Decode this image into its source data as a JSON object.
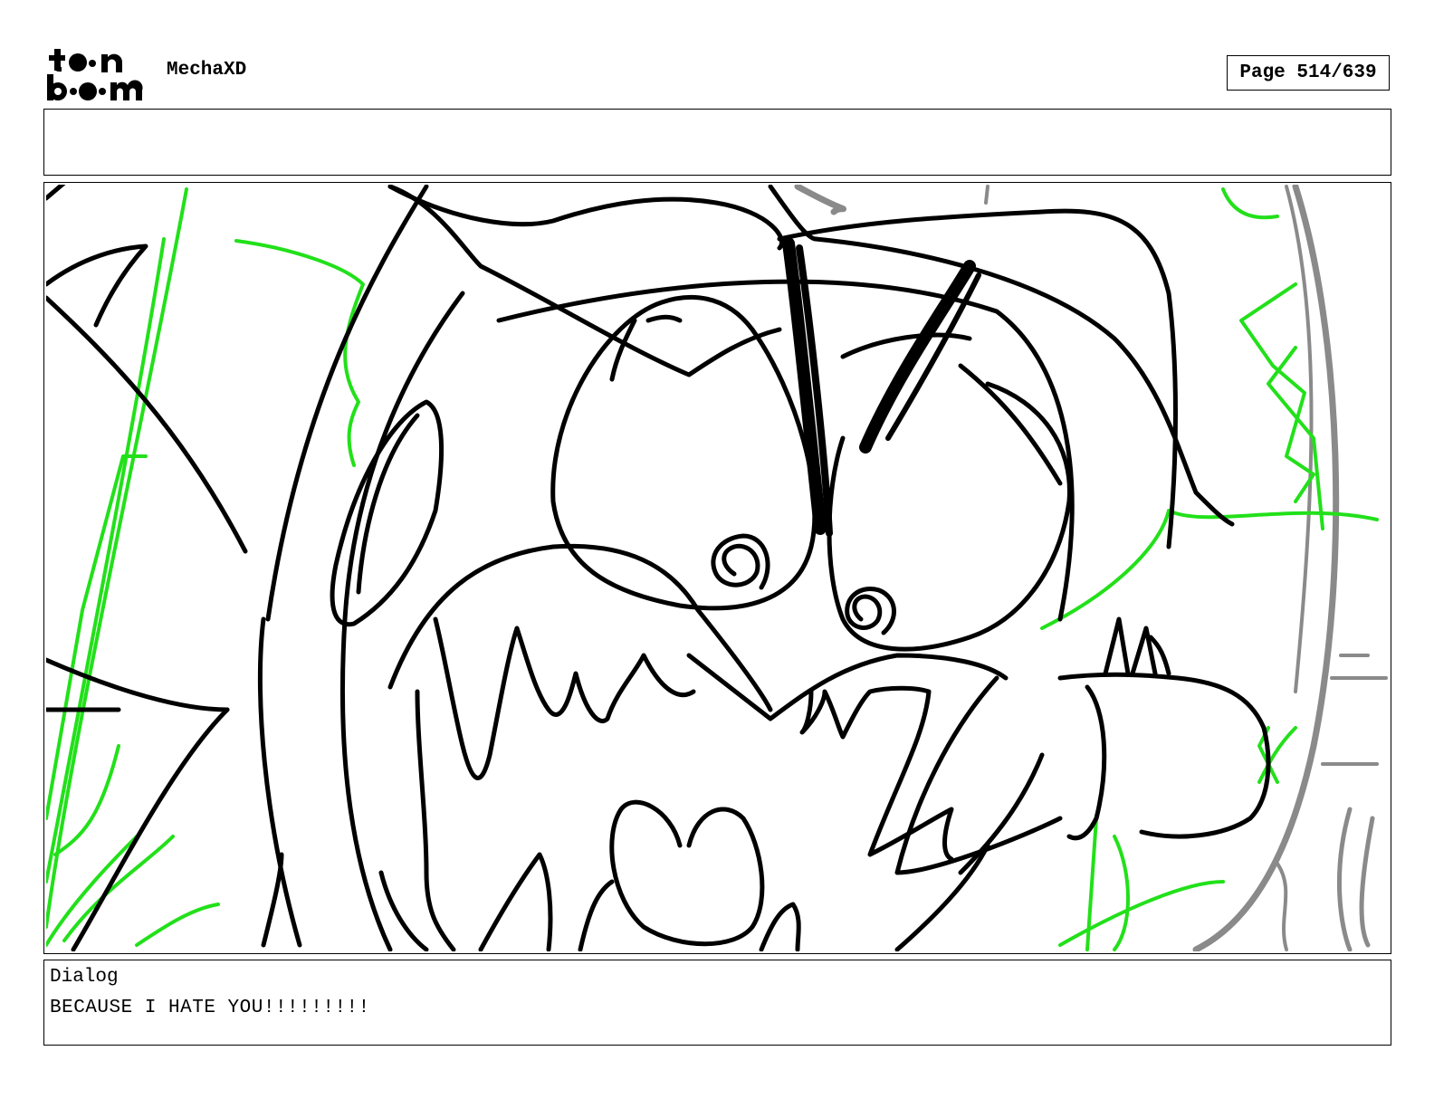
{
  "header": {
    "logo_text": "toon boom",
    "project_title": "MechaXD",
    "page_indicator": "Page 514/639"
  },
  "notes": {
    "text": ""
  },
  "dialog": {
    "label": "Dialog",
    "text": "BECAUSE I HATE YOU!!!!!!!!!"
  },
  "colors": {
    "sketch_black": "#000000",
    "sketch_green": "#22e01a",
    "sketch_gray": "#8a8a8a",
    "border": "#000000"
  }
}
